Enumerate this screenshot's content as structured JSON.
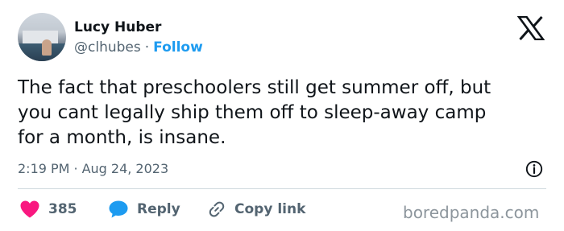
{
  "author": {
    "name": "Lucy Huber",
    "handle": "@clhubes",
    "separator": "·",
    "follow_label": "Follow"
  },
  "tweet": {
    "lines": [
      "The fact that preschoolers still get summer off, but",
      "you cant legally ship them off to sleep-away camp",
      "for a month, is insane."
    ],
    "time": "2:19 PM",
    "separator": "·",
    "date": "Aug 24, 2023"
  },
  "actions": {
    "like_count": "385",
    "reply_label": "Reply",
    "copy_link_label": "Copy link"
  },
  "watermark": "boredpanda.com",
  "icons": {
    "logo": "x-logo-icon",
    "info": "info-icon",
    "like": "heart-icon",
    "reply": "speech-bubble-icon",
    "copy": "link-icon"
  },
  "colors": {
    "accent": "#1d9bf0",
    "heart": "#f91880",
    "text": "#0f1419",
    "muted": "#536471"
  }
}
